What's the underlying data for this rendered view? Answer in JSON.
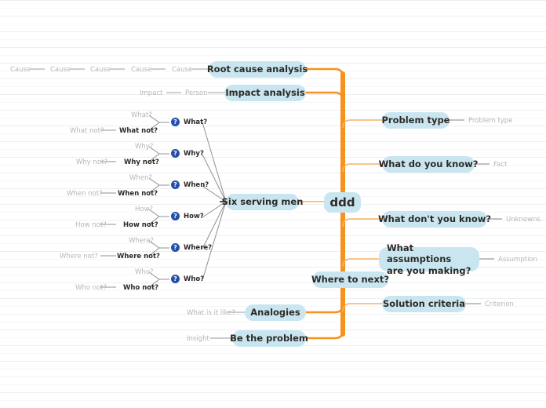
{
  "theme": {
    "node_fill": "#c9e6f0",
    "node_text": "#2d2a26",
    "trunk_color": "#f6921e",
    "branch_color": "#f7ad57",
    "thin_link": "#9a9c9e",
    "muted_text": "#b4b6b8",
    "icon_fill": "#2550a8",
    "rule_color": "#eceef0"
  },
  "center": {
    "label": "ddd"
  },
  "nodes": {
    "root_cause_analysis": "Root cause analysis",
    "impact_analysis": "Impact analysis",
    "six_serving_men": "Six serving men",
    "analogies": "Analogies",
    "be_the_problem": "Be the problem",
    "where_to_next": "Where to next?",
    "problem_type": "Problem type",
    "what_do_you_know": "What do you know?",
    "what_dont_you_know": "What don't you know?",
    "what_assumptions_line1": "What assumptions",
    "what_assumptions_line2": "are you making?",
    "solution_criteria": "Solution criteria"
  },
  "right_sublabels": {
    "problem_type": "Problem type",
    "fact": "Fact",
    "unknowns": "Unknowns",
    "assumption": "Assumption",
    "criterion": "Criterion"
  },
  "root_cause_chain": [
    "Cause",
    "Cause",
    "Cause",
    "Cause",
    "Cause"
  ],
  "impact_chain": [
    "Impact",
    "Person"
  ],
  "analogies_sub": "What is it like?",
  "be_the_problem_sub": "Insight",
  "icons": {
    "question": "?"
  },
  "six_serving_men_branches": [
    {
      "icon": "question-icon",
      "label": "What?",
      "child_grey": "What?",
      "child_dark": "What not?",
      "grandchild_grey": "What not?"
    },
    {
      "icon": "question-icon",
      "label": "Why?",
      "child_grey": "Why?",
      "child_dark": "Why not?",
      "grandchild_grey": "Why not?"
    },
    {
      "icon": "question-icon",
      "label": "When?",
      "child_grey": "When?",
      "child_dark": "When not?",
      "grandchild_grey": "When not?"
    },
    {
      "icon": "question-icon",
      "label": "How?",
      "child_grey": "How?",
      "child_dark": "How not?",
      "grandchild_grey": "How not?"
    },
    {
      "icon": "question-icon",
      "label": "Where?",
      "child_grey": "Where?",
      "child_dark": "Where not?",
      "grandchild_grey": "Where not?"
    },
    {
      "icon": "question-icon",
      "label": "Who?",
      "child_grey": "Who?",
      "child_dark": "Who not?",
      "grandchild_grey": "Who not?"
    }
  ]
}
